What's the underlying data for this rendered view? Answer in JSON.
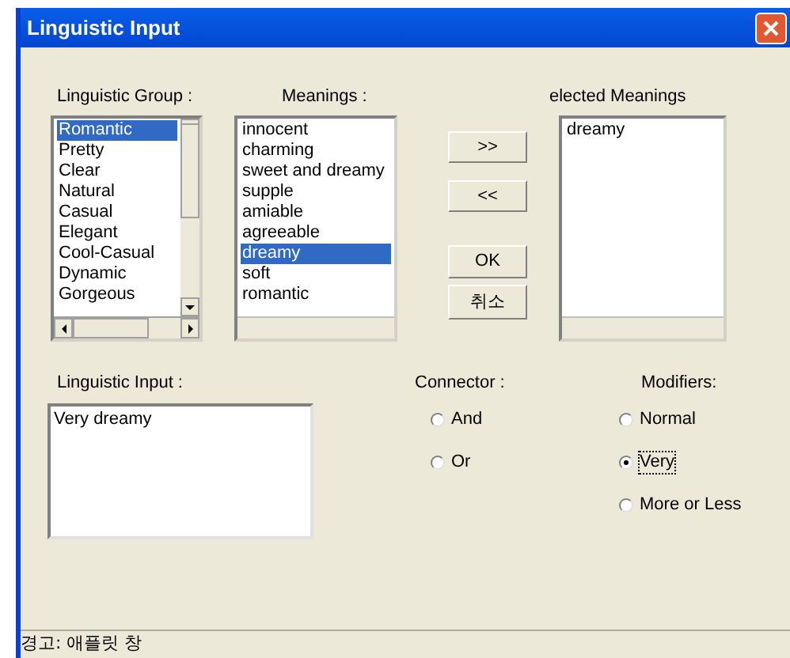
{
  "window": {
    "title": "Linguistic Input"
  },
  "linguistic_group": {
    "label": "Linguistic Group :",
    "items": [
      {
        "text": "Romantic",
        "selected": true
      },
      {
        "text": "Pretty",
        "selected": false
      },
      {
        "text": "Clear",
        "selected": false
      },
      {
        "text": "Natural",
        "selected": false
      },
      {
        "text": "Casual",
        "selected": false
      },
      {
        "text": "Elegant",
        "selected": false
      },
      {
        "text": "Cool-Casual",
        "selected": false
      },
      {
        "text": "Dynamic",
        "selected": false
      },
      {
        "text": "Gorgeous",
        "selected": false
      }
    ]
  },
  "meanings": {
    "label": "Meanings :",
    "items": [
      {
        "text": "innocent",
        "selected": false
      },
      {
        "text": "charming",
        "selected": false
      },
      {
        "text": "sweet and dreamy",
        "selected": false
      },
      {
        "text": "supple",
        "selected": false
      },
      {
        "text": "amiable",
        "selected": false
      },
      {
        "text": "agreeable",
        "selected": false
      },
      {
        "text": "dreamy",
        "selected": true
      },
      {
        "text": "soft",
        "selected": false
      },
      {
        "text": "romantic",
        "selected": false
      }
    ]
  },
  "buttons": [
    {
      "label": ">>"
    },
    {
      "label": "<<"
    },
    {
      "label": "OK"
    },
    {
      "label": "취소"
    }
  ],
  "selected_meanings": {
    "label": "elected Meanings",
    "items": [
      {
        "text": "dreamy",
        "selected": false
      }
    ]
  },
  "linguistic_input": {
    "label": "Linguistic Input :",
    "value": "Very dreamy"
  },
  "connector": {
    "label": "Connector :",
    "options": [
      {
        "label": "And",
        "selected": false
      },
      {
        "label": "Or",
        "selected": false
      }
    ]
  },
  "modifiers": {
    "label": "Modifiers:",
    "options": [
      {
        "label": "Normal",
        "selected": false
      },
      {
        "label": "Very",
        "selected": true
      },
      {
        "label": "More or Less",
        "selected": false
      }
    ]
  },
  "status_bar": "경고: 애플릿 창"
}
